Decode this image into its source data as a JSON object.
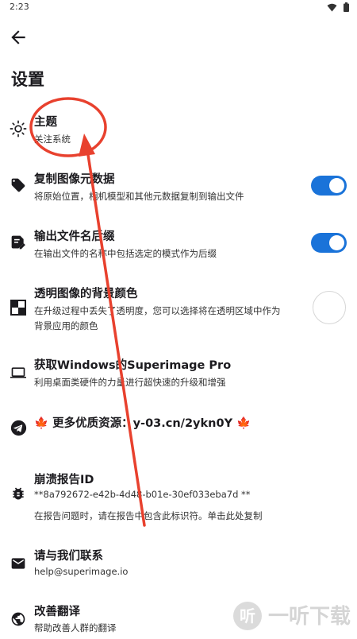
{
  "status": {
    "time": "2:23"
  },
  "page": {
    "title": "设置"
  },
  "settings": [
    {
      "title": "主题",
      "subtitle": "关注系统"
    },
    {
      "title": "复制图像元数据",
      "subtitle": "将原始位置，相机模型和其他元数据复制到输出文件",
      "toggle_on": true
    },
    {
      "title": "输出文件名后缀",
      "subtitle": "在输出文件的名称中包括选定的模式作为后缀",
      "toggle_on": true
    },
    {
      "title": "透明图像的背景颜色",
      "subtitle_line1": "在升级过程中丢失了透明度，您可以选择将在透明区域中作为",
      "subtitle_line2": "背景应用的颜色"
    },
    {
      "title": "获取Windows的Superimage Pro",
      "subtitle": "利用桌面类硬件的力量进行超快速的升级和增强"
    },
    {
      "title": "🍁 更多优质资源：y-03.cn/2ykn0Y 🍁"
    },
    {
      "title": "崩溃报告ID",
      "subtitle_line1": "**8a792672-e42b-4d48-b01e-30ef033eba7d **",
      "subtitle_line2": "在报告问题时，请在报告中包含此标识符。单击此处复制"
    },
    {
      "title": "请与我们联系",
      "subtitle": "help@superimage.io"
    },
    {
      "title": "改善翻译",
      "subtitle": "帮助改善人群的翻译"
    }
  ],
  "watermark": {
    "text": "一听下载"
  },
  "colors": {
    "accent": "#1a73d9",
    "annotation": "#e8412e"
  }
}
